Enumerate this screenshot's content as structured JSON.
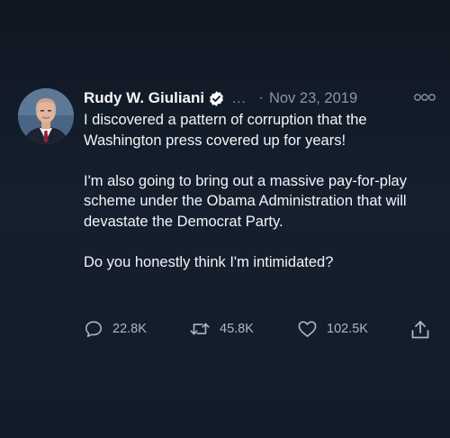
{
  "tweet": {
    "author_name": "Rudy W. Giuliani",
    "ellipsis": "...",
    "separator": "·",
    "date": "Nov 23, 2019",
    "paragraphs": [
      "I discovered a pattern of corruption that the Washington press covered up for years!",
      "I'm also going to bring out a massive pay-for-play scheme under the Obama Administration that will devastate the Democrat Party.",
      "Do you honestly think I'm intimidated?"
    ],
    "reply_count": "22.8K",
    "retweet_count": "45.8K",
    "like_count": "102.5K"
  },
  "icons": {
    "verified": "verified-badge-icon",
    "more": "more-options-icon",
    "reply": "reply-bubble-icon",
    "retweet": "retweet-arrows-icon",
    "like": "heart-icon",
    "share": "share-upload-icon"
  },
  "colors": {
    "background": "#121a26",
    "text": "#f2f5f7",
    "muted": "#8899a6",
    "action_icon": "#aab8c2",
    "verified_badge": "#ffffff"
  }
}
